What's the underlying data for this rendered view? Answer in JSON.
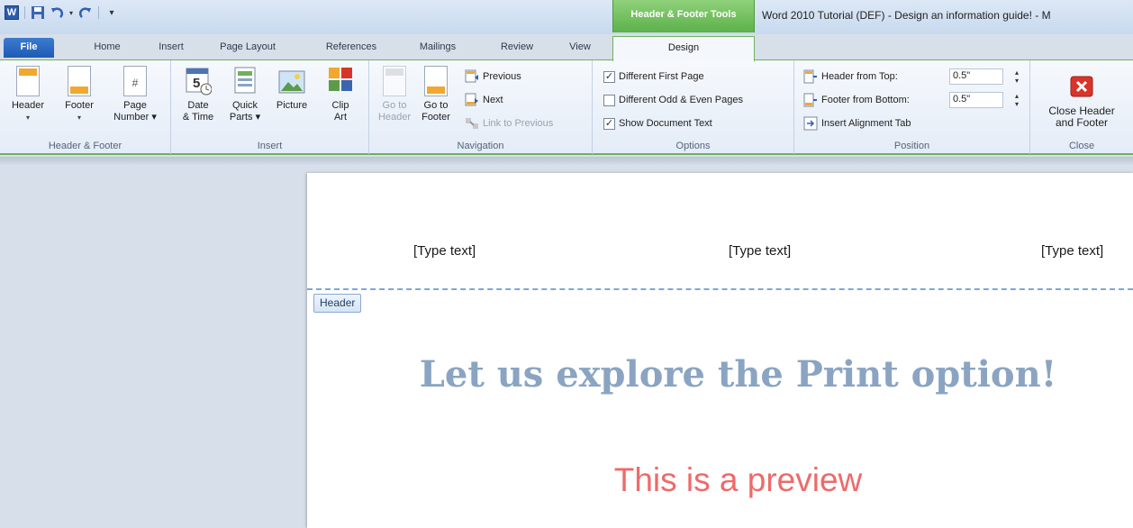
{
  "window": {
    "contextual_tab_title": "Header & Footer Tools",
    "title": "Word 2010 Tutorial (DEF) - Design an information guide! - M"
  },
  "qat": {
    "logo_letter": "W",
    "customize_glyph": "▾"
  },
  "tabs": [
    {
      "label": "File"
    },
    {
      "label": "Home"
    },
    {
      "label": "Insert"
    },
    {
      "label": "Page Layout"
    },
    {
      "label": "References"
    },
    {
      "label": "Mailings"
    },
    {
      "label": "Review"
    },
    {
      "label": "View"
    },
    {
      "label": "Design"
    }
  ],
  "ribbon": {
    "header_footer": {
      "label": "Header & Footer",
      "header": "Header",
      "footer": "Footer",
      "page_number_1": "Page",
      "page_number_2": "Number ▾"
    },
    "insert": {
      "label": "Insert",
      "date_time_1": "Date",
      "date_time_2": "& Time",
      "quick_parts_1": "Quick",
      "quick_parts_2": "Parts ▾",
      "picture": "Picture",
      "clip_art_1": "Clip",
      "clip_art_2": "Art",
      "calendar_number": "5"
    },
    "navigation": {
      "label": "Navigation",
      "go_to_header_1": "Go to",
      "go_to_header_2": "Header",
      "go_to_footer_1": "Go to",
      "go_to_footer_2": "Footer",
      "previous": "Previous",
      "next": "Next",
      "link_to_previous": "Link to Previous"
    },
    "options": {
      "label": "Options",
      "different_first_page": "Different First Page",
      "different_odd_even": "Different Odd & Even Pages",
      "show_document_text": "Show Document Text",
      "different_first_page_checked": true,
      "different_odd_even_checked": false,
      "show_document_text_checked": true
    },
    "position": {
      "label": "Position",
      "header_from_top": "Header from Top:",
      "header_from_top_value": "0.5\"",
      "footer_from_bottom": "Footer from Bottom:",
      "footer_from_bottom_value": "0.5\"",
      "insert_alignment_tab": "Insert Alignment Tab"
    },
    "close": {
      "label": "Close",
      "close_1": "Close Header",
      "close_2": "and Footer"
    }
  },
  "document": {
    "header_left": "[Type text]",
    "header_center": "[Type text]",
    "header_right": "[Type text]",
    "header_tag": "Header",
    "title": "Let us explore the Print option!",
    "subtitle": "This is a preview"
  },
  "colors": {
    "accent_green": "#6fb15c",
    "title_blue": "#8aa4c2",
    "subtitle_red": "#ee6a6a",
    "file_tab_blue": "#1e5bb5",
    "close_red": "#d9342b"
  }
}
